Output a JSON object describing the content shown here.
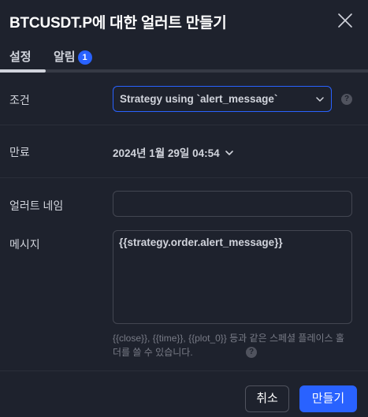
{
  "dialog": {
    "title": "BTCUSDT.P에 대한 얼러트 만들기",
    "close_icon": "close-icon"
  },
  "tabs": [
    {
      "label": "설정",
      "active": true
    },
    {
      "label": "알림",
      "badge": "1",
      "active": false
    }
  ],
  "settings": {
    "condition": {
      "label": "조건",
      "value": "Strategy using `alert_message`"
    },
    "expiry": {
      "label": "만료",
      "value": "2024년 1월 29일 04:54"
    },
    "alert_name": {
      "label": "얼러트 네임",
      "value": ""
    },
    "message": {
      "label": "메시지",
      "value": "{{strategy.order.alert_message}}",
      "hint": "{{close}}, {{time}}, {{plot_0}} 등과 같은 스페셜 플레이스 홀더를 쓸 수 있습니다."
    },
    "help_glyph": "?"
  },
  "footer": {
    "cancel_label": "취소",
    "create_label": "만들기"
  },
  "colors": {
    "background": "#1e222d",
    "accent": "#2962ff",
    "text": "#d1d4dc",
    "muted": "#787b86",
    "border": "#434651"
  }
}
